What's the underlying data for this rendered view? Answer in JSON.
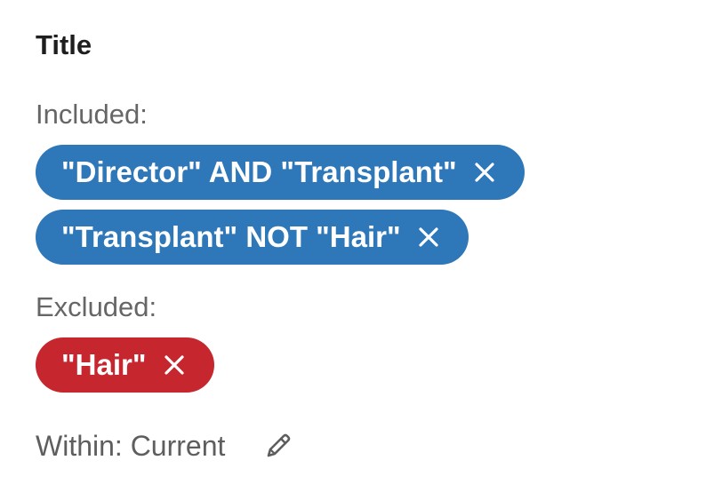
{
  "section": {
    "title": "Title"
  },
  "included": {
    "label": "Included:",
    "chips": [
      {
        "text": "\"Director\" AND \"Transplant\"",
        "remove_icon": "close-icon"
      },
      {
        "text": "\"Transplant\" NOT \"Hair\"",
        "remove_icon": "close-icon"
      }
    ]
  },
  "excluded": {
    "label": "Excluded:",
    "chips": [
      {
        "text": "\"Hair\"",
        "remove_icon": "close-icon"
      }
    ]
  },
  "within": {
    "text": "Within: Current",
    "edit_icon": "pencil-icon"
  },
  "colors": {
    "included_chip": "#2e77b8",
    "excluded_chip": "#c6262e",
    "label_text": "#666666"
  }
}
